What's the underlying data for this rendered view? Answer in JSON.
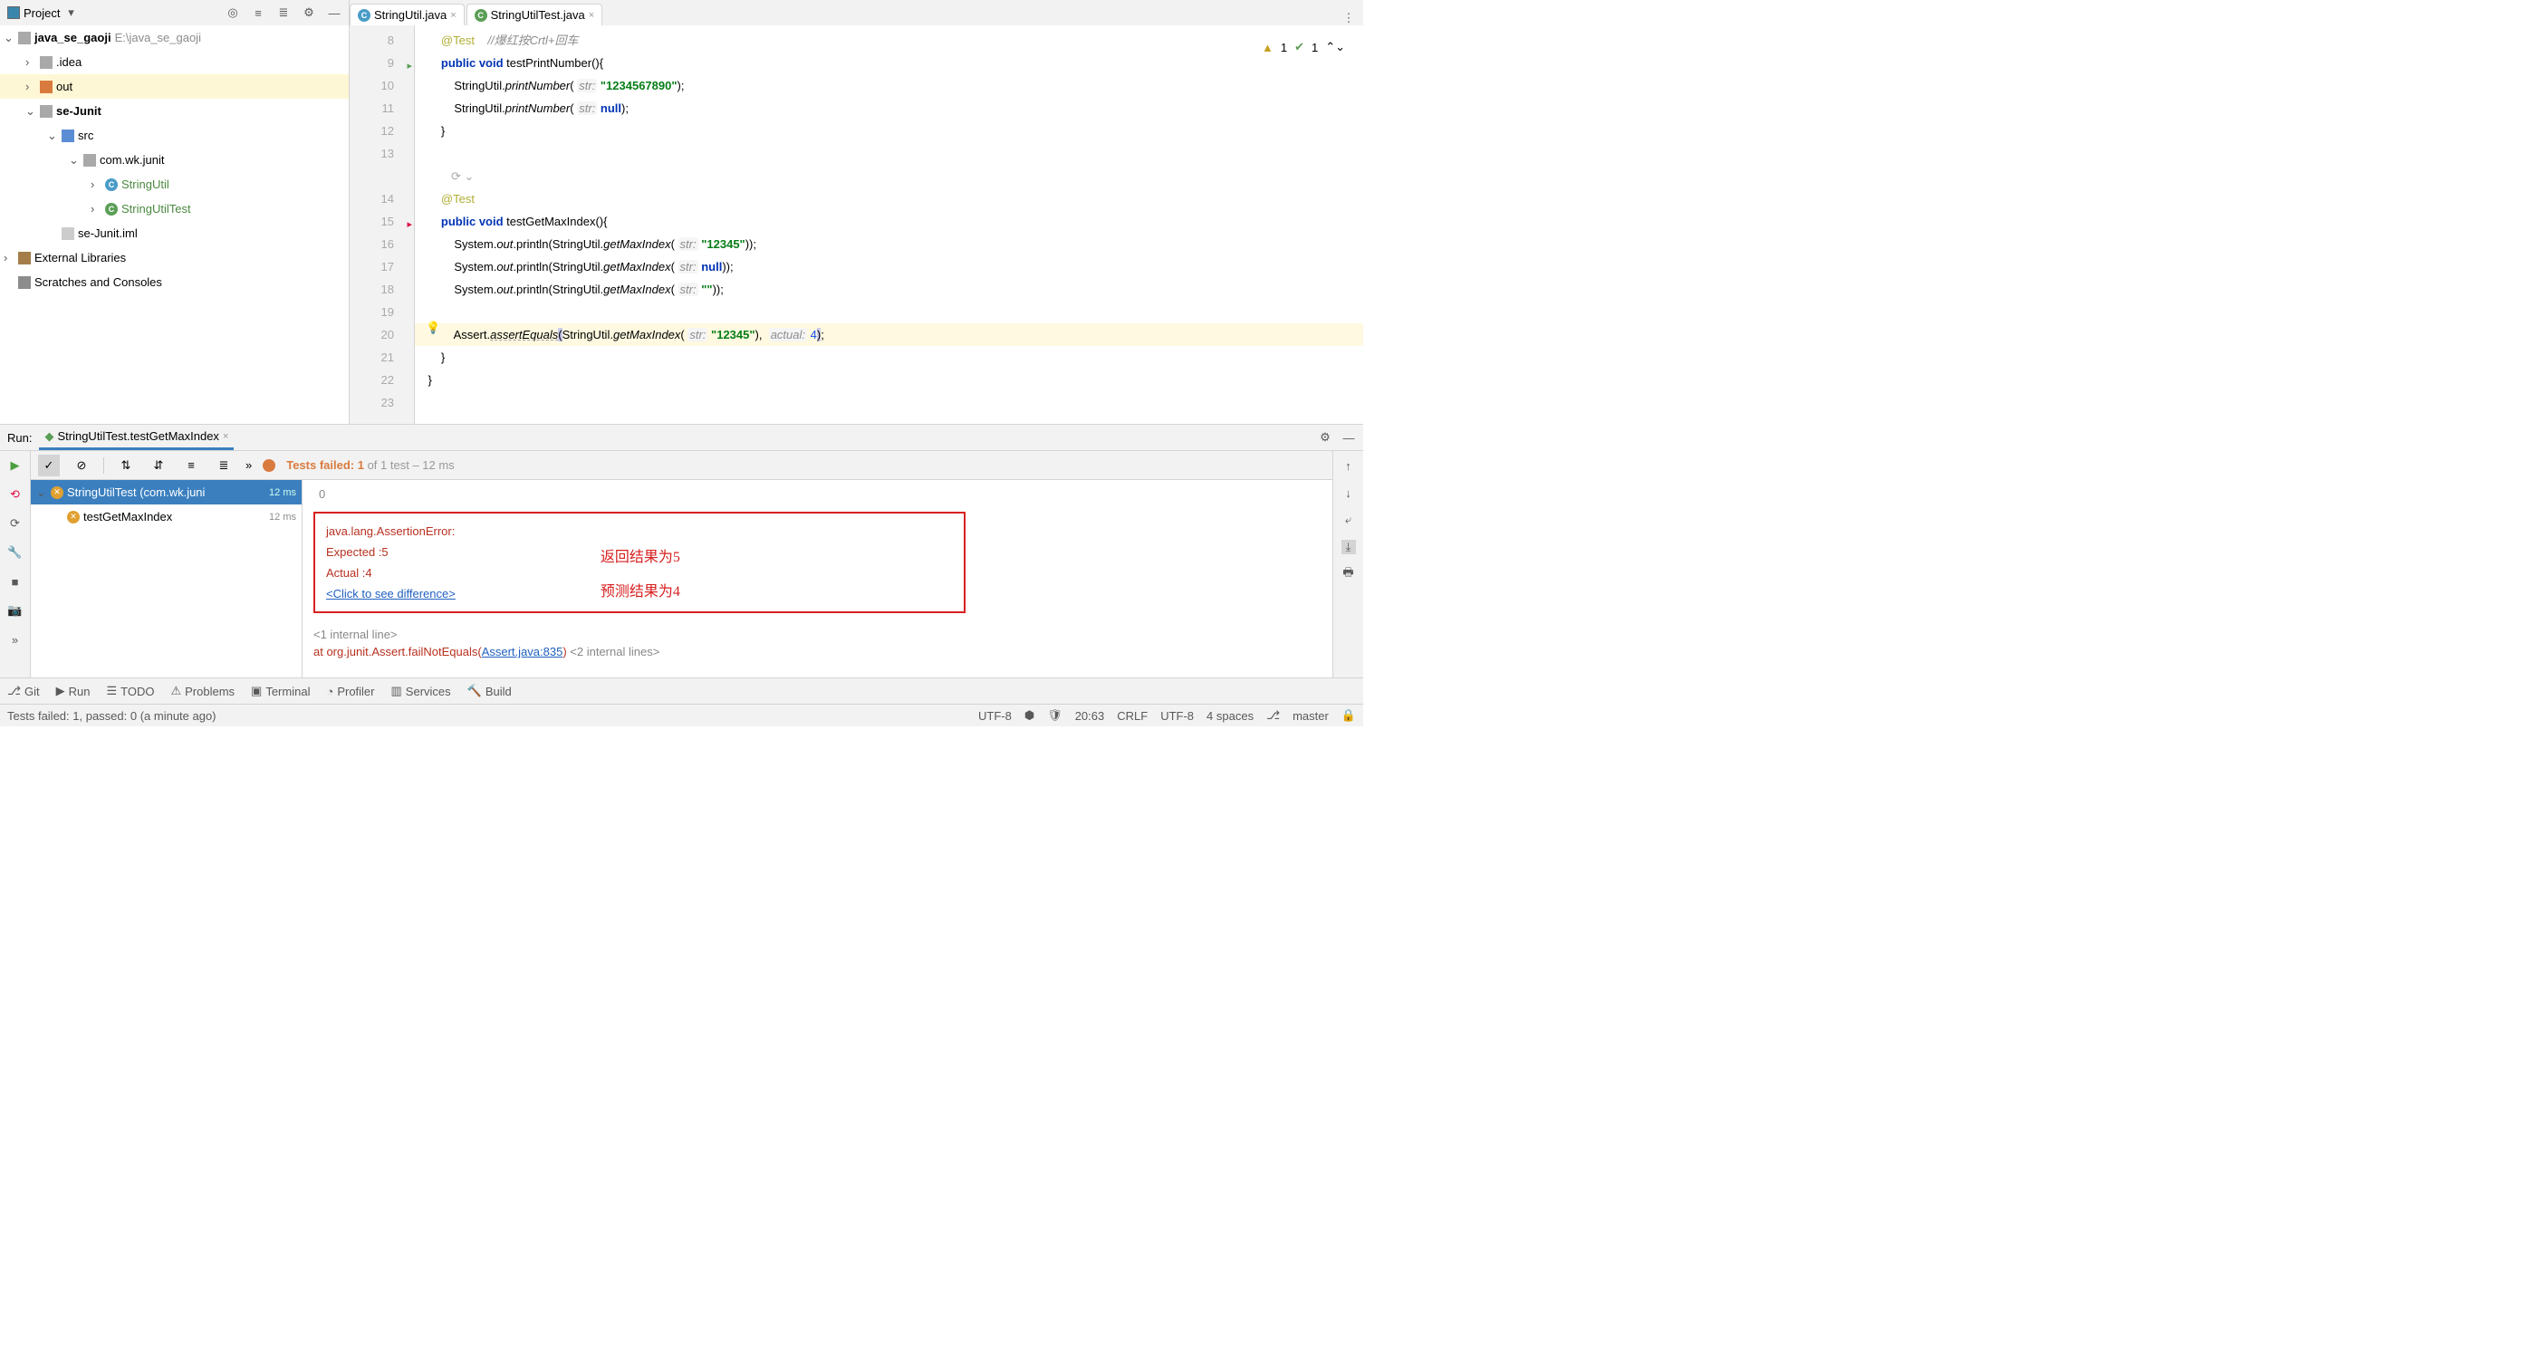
{
  "toolbar": {
    "project_label": "Project"
  },
  "tabs": {
    "t1": "StringUtil.java",
    "t2": "StringUtilTest.java"
  },
  "tree": {
    "root": "java_se_gaoji",
    "root_path": "E:\\java_se_gaoji",
    "idea": ".idea",
    "out": "out",
    "sejunit": "se-Junit",
    "src": "src",
    "pkg": "com.wk.junit",
    "c1": "StringUtil",
    "c2": "StringUtilTest",
    "iml": "se-Junit.iml",
    "ext": "External Libraries",
    "scr": "Scratches and Consoles"
  },
  "gutter": {
    "l8": "8",
    "l9": "9",
    "l10": "10",
    "l11": "11",
    "l12": "12",
    "l13": "13",
    "l14": "14",
    "l15": "15",
    "l16": "16",
    "l17": "17",
    "l18": "18",
    "l19": "19",
    "l20": "20",
    "l21": "21",
    "l22": "22",
    "l23": "23"
  },
  "code": {
    "test": "@Test",
    "comment": "//爆红按Crtl+回车",
    "public": "public",
    "void": "void",
    "fn1": "testPrintNumber",
    "fn2": "testGetMaxIndex",
    "su": "StringUtil",
    "pn": "printNumber",
    "gmi": "getMaxIndex",
    "sys": "System",
    "out": "out",
    "pl": "println",
    "assert": "Assert",
    "ae": "assertEquals",
    "hint_str": "str:",
    "hint_actual": "actual:",
    "s1": "\"1234567890\"",
    "null": "null",
    "s2": "\"12345\"",
    "s3": "\"\"",
    "n4": "4"
  },
  "indicators": {
    "warn": "1",
    "ok": "1"
  },
  "run": {
    "label": "Run:",
    "tab": "StringUtilTest.testGetMaxIndex",
    "tests_failed": "Tests failed: 1",
    "tests_tail": " of 1 test – 12 ms",
    "class": "StringUtilTest (com.wk.juni",
    "class_time": "12 ms",
    "method": "testGetMaxIndex",
    "method_time": "12 ms"
  },
  "console": {
    "zero": "0",
    "err": "java.lang.AssertionError:",
    "exp": "Expected :5",
    "act": "Actual   :4",
    "link": "<Click to see difference>",
    "ann1": "返回结果为5",
    "ann2": "预测结果为4",
    "int1": "<1 internal line>",
    "int2": "<2 internal lines>",
    "at": "at org.junit.Assert.failNotEquals(",
    "atlink": "Assert.java:835",
    "atclose": ")"
  },
  "bottom": {
    "git": "Git",
    "run": "Run",
    "todo": "TODO",
    "prob": "Problems",
    "term": "Terminal",
    "prof": "Profiler",
    "serv": "Services",
    "build": "Build"
  },
  "status": {
    "msg": "Tests failed: 1, passed: 0 (a minute ago)",
    "enc1": "UTF-8",
    "enc2": "UTF-8",
    "pos": "20:63",
    "crlf": "CRLF",
    "spaces": "4 spaces",
    "branch": "master"
  }
}
